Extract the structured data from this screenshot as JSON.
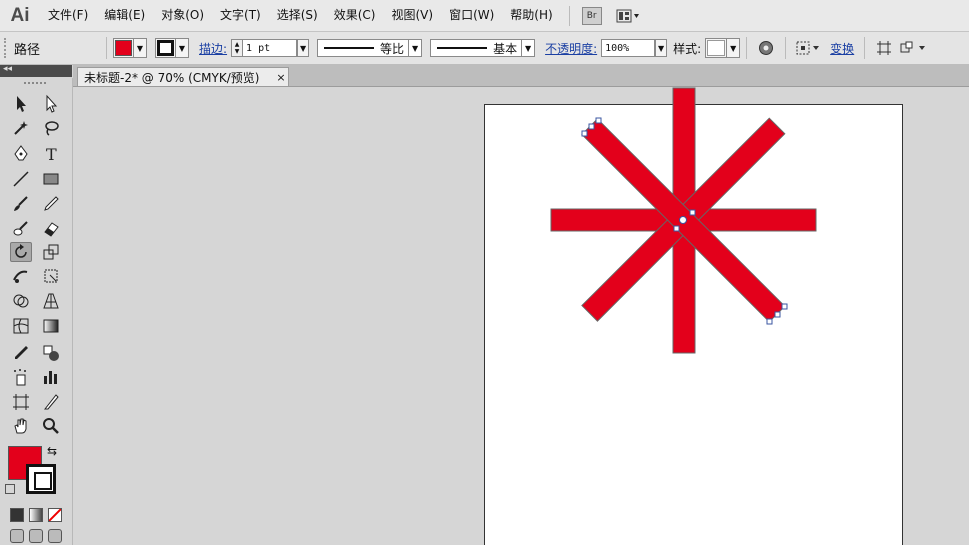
{
  "app": {
    "logo": "Ai"
  },
  "menu": [
    "文件(F)",
    "编辑(E)",
    "对象(O)",
    "文字(T)",
    "选择(S)",
    "效果(C)",
    "视图(V)",
    "窗口(W)",
    "帮助(H)"
  ],
  "menu_extras": {
    "bridge": "Br"
  },
  "control_bar": {
    "selection_label": "路径",
    "fill_color": "#e3001b",
    "stroke_label": "描边:",
    "stroke_weight": "1 pt",
    "profile_label": "等比",
    "brush_label": "基本",
    "opacity_label": "不透明度:",
    "opacity_value": "100%",
    "style_label": "样式:",
    "transform_label": "变换"
  },
  "document": {
    "tab_title": "未标题-2* @ 70% (CMYK/预览)",
    "close": "×"
  },
  "colors": {
    "fill": "#e3001b",
    "stroke": "#111111",
    "artboard": "#ffffff",
    "pasteboard": "#d6d6d6"
  },
  "tools": [
    "selection-icon",
    "direct-selection-icon",
    "magic-wand-icon",
    "lasso-icon",
    "pen-icon",
    "type-icon",
    "line-icon",
    "rectangle-icon",
    "paintbrush-icon",
    "pencil-icon",
    "blob-brush-icon",
    "eraser-icon",
    "rotate-icon",
    "scale-icon",
    "warp-icon",
    "free-transform-icon",
    "shape-builder-icon",
    "perspective-grid-icon",
    "mesh-icon",
    "gradient-icon",
    "eyedropper-icon",
    "blend-icon",
    "symbol-sprayer-icon",
    "column-graph-icon",
    "artboard-icon",
    "slice-icon",
    "hand-icon",
    "zoom-icon"
  ],
  "tool_labels": {
    "type": "T"
  }
}
